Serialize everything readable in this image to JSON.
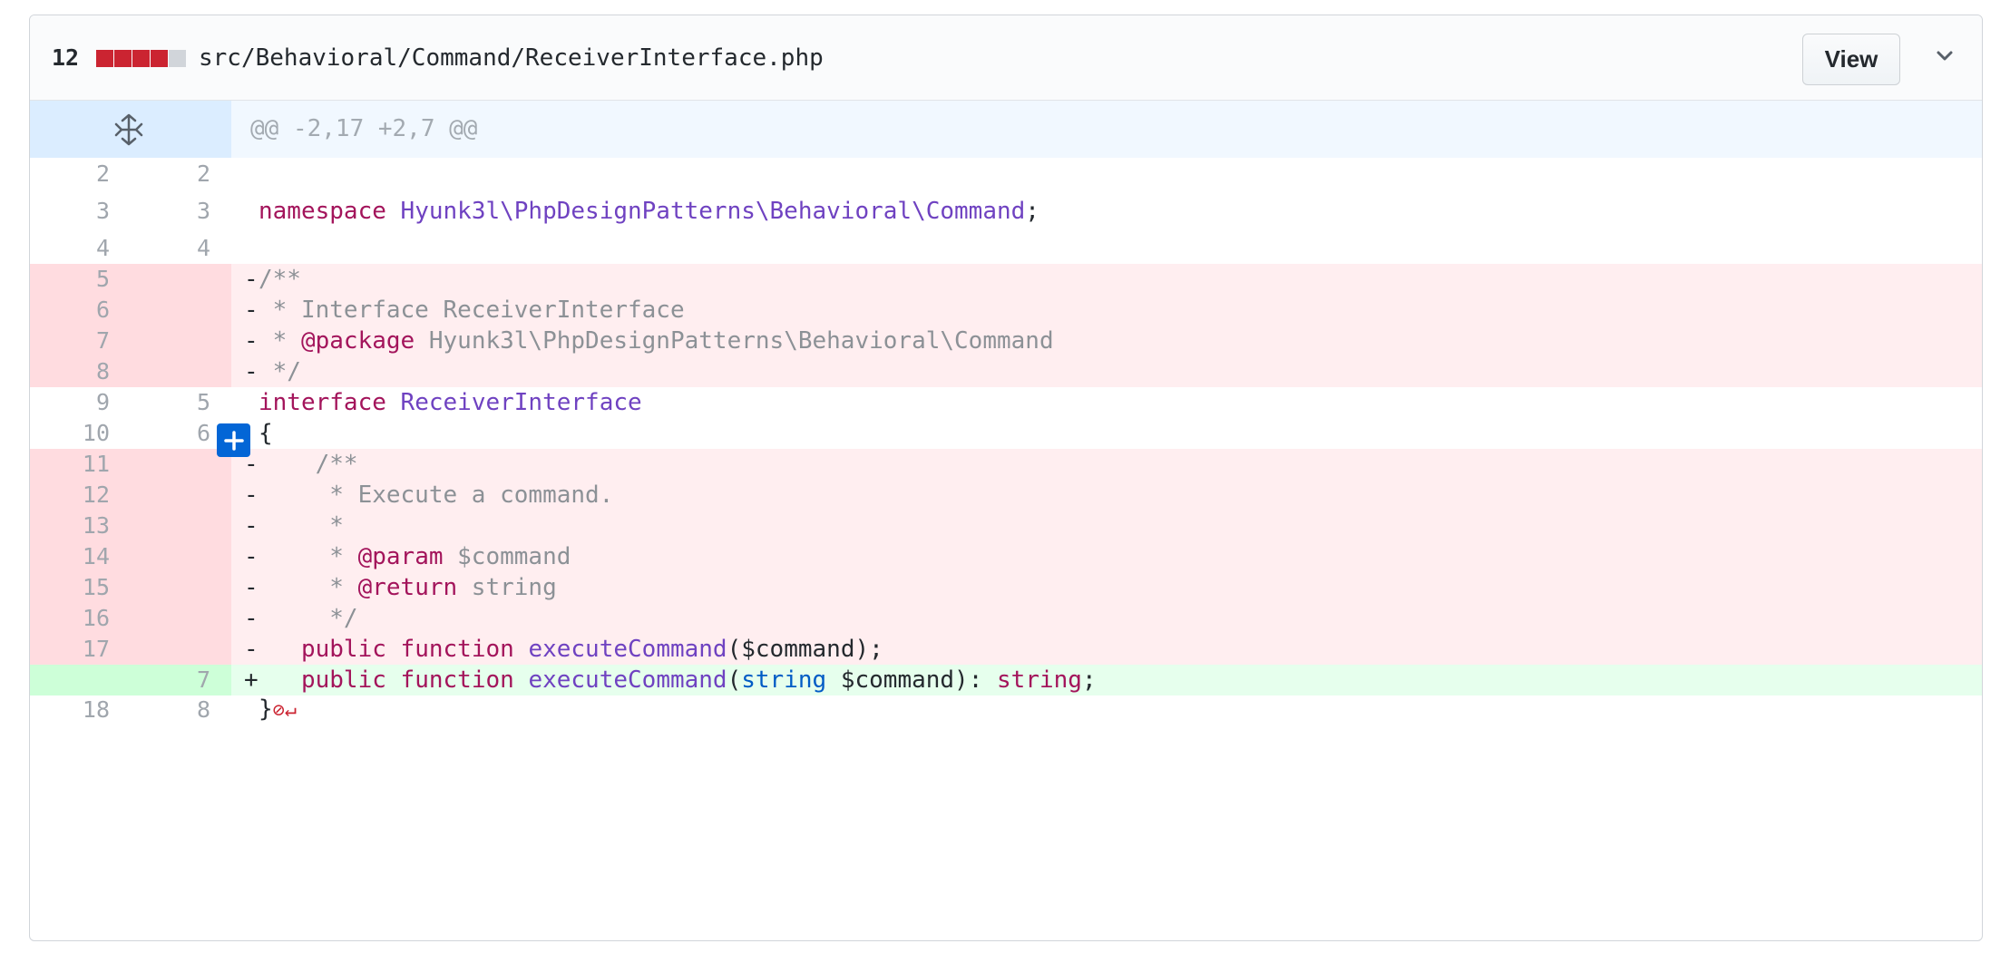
{
  "header": {
    "changes_count": "12",
    "diffstat_colors": [
      "#cb2431",
      "#cb2431",
      "#cb2431",
      "#cb2431",
      "#d1d5da"
    ],
    "filename": "src/Behavioral/Command/ReceiverInterface.php",
    "view_label": "View"
  },
  "hunk": {
    "header": "@@ -2,17 +2,7 @@"
  },
  "lines": [
    {
      "type": "ctx",
      "old": "2",
      "new": "2"
    },
    {
      "type": "ctx",
      "old": "3",
      "new": "3",
      "kw1": "namespace",
      "ns": "Hyunk3l\\PhpDesignPatterns\\Behavioral\\Command",
      "semi": ";"
    },
    {
      "type": "ctx",
      "old": "4",
      "new": "4"
    },
    {
      "type": "del",
      "old": "5",
      "marker": "-",
      "cmt": "/**"
    },
    {
      "type": "del",
      "old": "6",
      "marker": "-",
      "cmt": " * Interface ReceiverInterface"
    },
    {
      "type": "del",
      "old": "7",
      "marker": "-",
      "cmt1": " * ",
      "tag": "@package",
      "cmt2": " Hyunk3l\\PhpDesignPatterns\\Behavioral\\Command"
    },
    {
      "type": "del",
      "old": "8",
      "marker": "-",
      "cmt": " */"
    },
    {
      "type": "ctx",
      "old": "9",
      "new": "5",
      "kw1": "interface",
      "cls": "ReceiverInterface"
    },
    {
      "type": "ctx",
      "old": "10",
      "new": "6",
      "text": "{"
    },
    {
      "type": "del",
      "old": "11",
      "marker": "-",
      "cmt": "    /**"
    },
    {
      "type": "del",
      "old": "12",
      "marker": "-",
      "cmt": "     * Execute a command."
    },
    {
      "type": "del",
      "old": "13",
      "marker": "-",
      "cmt": "     *"
    },
    {
      "type": "del",
      "old": "14",
      "marker": "-",
      "cmt1": "     * ",
      "tag": "@param",
      "cmt2": " $command"
    },
    {
      "type": "del",
      "old": "15",
      "marker": "-",
      "cmt1": "     * ",
      "tag": "@return",
      "cmt2": " string"
    },
    {
      "type": "del",
      "old": "16",
      "marker": "-",
      "cmt": "     */"
    },
    {
      "type": "del",
      "old": "17",
      "marker": "-",
      "kw1": "public",
      "kw2": "function",
      "fn": "executeCommand",
      "args": "($command);"
    },
    {
      "type": "add",
      "new": "7",
      "marker": "+",
      "kw1": "public",
      "kw2": "function",
      "fn": "executeCommand",
      "p1": "(",
      "typ": "string",
      "p2": " $command): ",
      "ret": "string",
      "p3": ";"
    },
    {
      "type": "ctx",
      "old": "18",
      "new": "8",
      "text": "}"
    }
  ]
}
